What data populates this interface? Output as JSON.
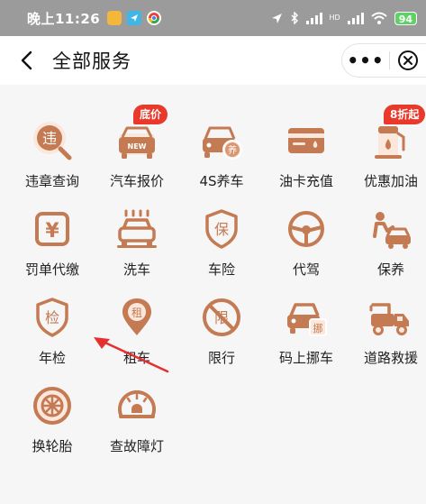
{
  "status_bar": {
    "time": "晚上11:26",
    "battery": "94",
    "hd_label": "HD"
  },
  "header": {
    "title": "全部服务",
    "more_label": "•••"
  },
  "colors": {
    "icon": "#c47a52",
    "badge": "#e8392b"
  },
  "services": [
    {
      "label": "违章查询",
      "icon": "violation-search-icon"
    },
    {
      "label": "汽车报价",
      "icon": "car-price-icon",
      "badge": "底价"
    },
    {
      "label": "4S养车",
      "icon": "car-maintain-icon"
    },
    {
      "label": "油卡充值",
      "icon": "fuel-card-icon"
    },
    {
      "label": "优惠加油",
      "icon": "fuel-pump-icon",
      "badge": "8折起"
    },
    {
      "label": "罚单代缴",
      "icon": "fine-pay-icon"
    },
    {
      "label": "洗车",
      "icon": "car-wash-icon"
    },
    {
      "label": "车险",
      "icon": "insurance-icon"
    },
    {
      "label": "代驾",
      "icon": "steering-wheel-icon"
    },
    {
      "label": "保养",
      "icon": "repair-icon"
    },
    {
      "label": "年检",
      "icon": "annual-inspection-icon"
    },
    {
      "label": "租车",
      "icon": "rental-pin-icon"
    },
    {
      "label": "限行",
      "icon": "restriction-icon"
    },
    {
      "label": "码上挪车",
      "icon": "move-car-icon"
    },
    {
      "label": "道路救援",
      "icon": "tow-truck-icon"
    },
    {
      "label": "换轮胎",
      "icon": "tire-icon"
    },
    {
      "label": "查故障灯",
      "icon": "warning-light-icon"
    }
  ],
  "icon_text": {
    "violation": "违",
    "car_new": "NEW",
    "maintain": "养",
    "fine": "¥",
    "insurance": "保",
    "inspection": "检",
    "rental": "租",
    "restriction": "限",
    "move": "挪"
  }
}
